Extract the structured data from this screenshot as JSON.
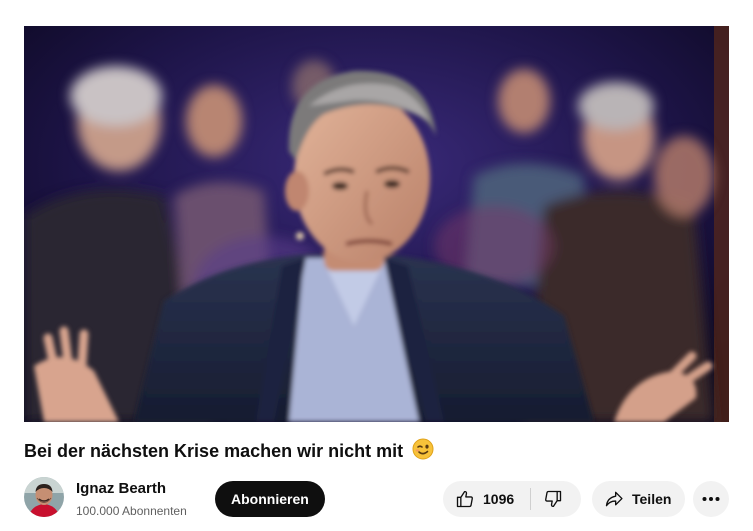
{
  "video": {
    "title": "Bei der nächsten Krise machen wir nicht mit",
    "title_emoji": "winking-face-emoji"
  },
  "channel": {
    "name": "Ignaz Bearth",
    "subscribers": "100.000 Abonnenten",
    "subscribe_label": "Abonnieren"
  },
  "actions": {
    "like_count": "1096",
    "share_label": "Teilen",
    "icons": [
      "thumbs-up-icon",
      "thumbs-down-icon",
      "share-arrow-icon",
      "more-horizontal-icon"
    ]
  },
  "colors": {
    "subscribe_bg": "#0f0f0f",
    "action_bg": "#f2f2f2",
    "secondary_text": "#606060",
    "stage_bg": "#120c2a"
  }
}
